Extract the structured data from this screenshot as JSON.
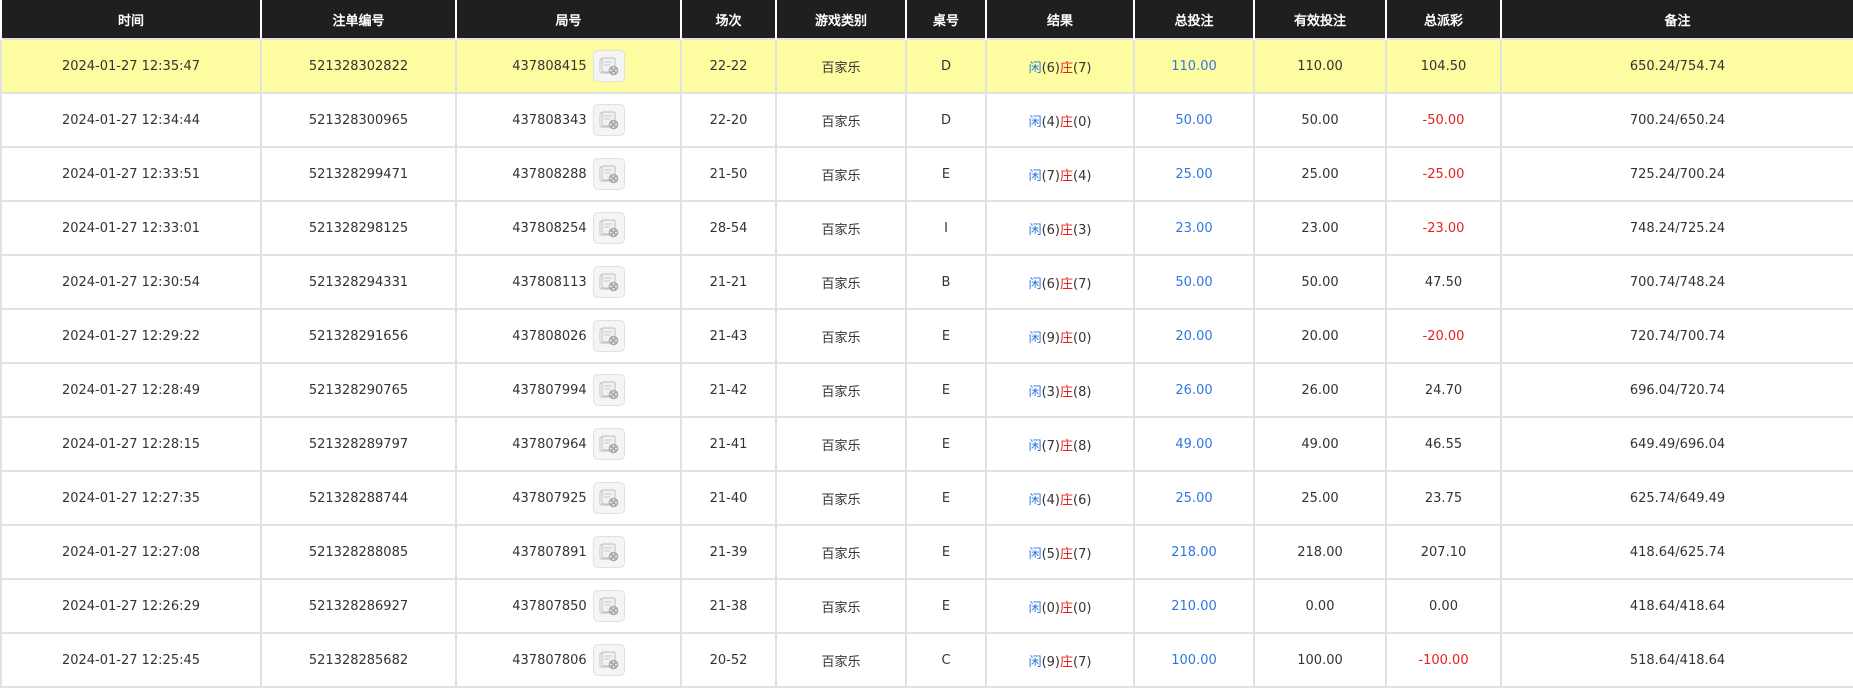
{
  "colors": {
    "header_bg": "#1f1f1f",
    "highlight_row": "#fdfca0",
    "player": "#2f78e0",
    "banker": "#e82020",
    "negative": "#e82020",
    "bet_total": "#2f78e0"
  },
  "table": {
    "headers": [
      "时间",
      "注单编号",
      "局号",
      "场次",
      "游戏类别",
      "桌号",
      "结果",
      "总投注",
      "有效投注",
      "总派彩",
      "备注"
    ],
    "player_label": "闲",
    "banker_label": "庄",
    "round_icon": "game-replay-icon",
    "rows": [
      {
        "time": "2024-01-27 12:35:47",
        "order_id": "521328302822",
        "round_id": "437808415",
        "session": "22-22",
        "game_type": "百家乐",
        "table_no": "D",
        "player_score": "(6)",
        "banker_score": "(7)",
        "total_bet": "110.00",
        "valid_bet": "110.00",
        "payout": "104.50",
        "payout_negative": false,
        "remark": "650.24/754.74",
        "highlight": true
      },
      {
        "time": "2024-01-27 12:34:44",
        "order_id": "521328300965",
        "round_id": "437808343",
        "session": "22-20",
        "game_type": "百家乐",
        "table_no": "D",
        "player_score": "(4)",
        "banker_score": "(0)",
        "total_bet": "50.00",
        "valid_bet": "50.00",
        "payout": "-50.00",
        "payout_negative": true,
        "remark": "700.24/650.24",
        "highlight": false
      },
      {
        "time": "2024-01-27 12:33:51",
        "order_id": "521328299471",
        "round_id": "437808288",
        "session": "21-50",
        "game_type": "百家乐",
        "table_no": "E",
        "player_score": "(7)",
        "banker_score": "(4)",
        "total_bet": "25.00",
        "valid_bet": "25.00",
        "payout": "-25.00",
        "payout_negative": true,
        "remark": "725.24/700.24",
        "highlight": false
      },
      {
        "time": "2024-01-27 12:33:01",
        "order_id": "521328298125",
        "round_id": "437808254",
        "session": "28-54",
        "game_type": "百家乐",
        "table_no": "I",
        "player_score": "(6)",
        "banker_score": "(3)",
        "total_bet": "23.00",
        "valid_bet": "23.00",
        "payout": "-23.00",
        "payout_negative": true,
        "remark": "748.24/725.24",
        "highlight": false
      },
      {
        "time": "2024-01-27 12:30:54",
        "order_id": "521328294331",
        "round_id": "437808113",
        "session": "21-21",
        "game_type": "百家乐",
        "table_no": "B",
        "player_score": "(6)",
        "banker_score": "(7)",
        "total_bet": "50.00",
        "valid_bet": "50.00",
        "payout": "47.50",
        "payout_negative": false,
        "remark": "700.74/748.24",
        "highlight": false
      },
      {
        "time": "2024-01-27 12:29:22",
        "order_id": "521328291656",
        "round_id": "437808026",
        "session": "21-43",
        "game_type": "百家乐",
        "table_no": "E",
        "player_score": "(9)",
        "banker_score": "(0)",
        "total_bet": "20.00",
        "valid_bet": "20.00",
        "payout": "-20.00",
        "payout_negative": true,
        "remark": "720.74/700.74",
        "highlight": false
      },
      {
        "time": "2024-01-27 12:28:49",
        "order_id": "521328290765",
        "round_id": "437807994",
        "session": "21-42",
        "game_type": "百家乐",
        "table_no": "E",
        "player_score": "(3)",
        "banker_score": "(8)",
        "total_bet": "26.00",
        "valid_bet": "26.00",
        "payout": "24.70",
        "payout_negative": false,
        "remark": "696.04/720.74",
        "highlight": false
      },
      {
        "time": "2024-01-27 12:28:15",
        "order_id": "521328289797",
        "round_id": "437807964",
        "session": "21-41",
        "game_type": "百家乐",
        "table_no": "E",
        "player_score": "(7)",
        "banker_score": "(8)",
        "total_bet": "49.00",
        "valid_bet": "49.00",
        "payout": "46.55",
        "payout_negative": false,
        "remark": "649.49/696.04",
        "highlight": false
      },
      {
        "time": "2024-01-27 12:27:35",
        "order_id": "521328288744",
        "round_id": "437807925",
        "session": "21-40",
        "game_type": "百家乐",
        "table_no": "E",
        "player_score": "(4)",
        "banker_score": "(6)",
        "total_bet": "25.00",
        "valid_bet": "25.00",
        "payout": "23.75",
        "payout_negative": false,
        "remark": "625.74/649.49",
        "highlight": false
      },
      {
        "time": "2024-01-27 12:27:08",
        "order_id": "521328288085",
        "round_id": "437807891",
        "session": "21-39",
        "game_type": "百家乐",
        "table_no": "E",
        "player_score": "(5)",
        "banker_score": "(7)",
        "total_bet": "218.00",
        "valid_bet": "218.00",
        "payout": "207.10",
        "payout_negative": false,
        "remark": "418.64/625.74",
        "highlight": false
      },
      {
        "time": "2024-01-27 12:26:29",
        "order_id": "521328286927",
        "round_id": "437807850",
        "session": "21-38",
        "game_type": "百家乐",
        "table_no": "E",
        "player_score": "(0)",
        "banker_score": "(0)",
        "total_bet": "210.00",
        "valid_bet": "0.00",
        "payout": "0.00",
        "payout_negative": false,
        "remark": "418.64/418.64",
        "highlight": false
      },
      {
        "time": "2024-01-27 12:25:45",
        "order_id": "521328285682",
        "round_id": "437807806",
        "session": "20-52",
        "game_type": "百家乐",
        "table_no": "C",
        "player_score": "(9)",
        "banker_score": "(7)",
        "total_bet": "100.00",
        "valid_bet": "100.00",
        "payout": "-100.00",
        "payout_negative": true,
        "remark": "518.64/418.64",
        "highlight": false
      }
    ]
  }
}
